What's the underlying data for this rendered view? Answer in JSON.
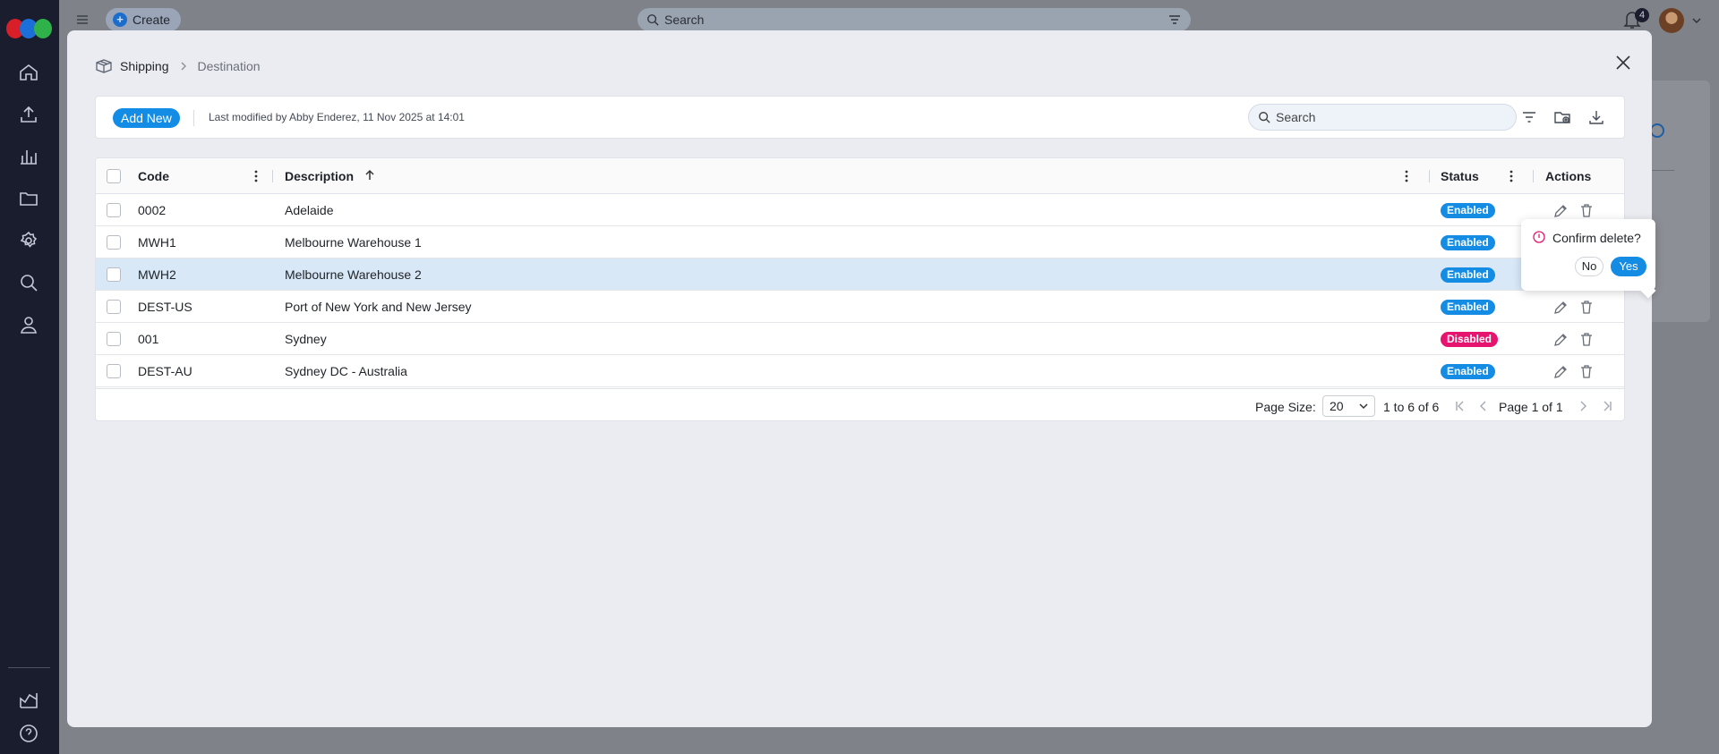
{
  "topbar": {
    "create_label": "Create",
    "search_placeholder": "Search",
    "notification_count": "4"
  },
  "modal": {
    "breadcrumb": {
      "root": "Shipping",
      "current": "Destination"
    },
    "toolbar": {
      "add_new_label": "Add New",
      "last_modified": "Last modified by Abby Enderez, 11 Nov 2025 at 14:01",
      "search_placeholder": "Search"
    },
    "grid": {
      "columns": {
        "code": "Code",
        "description": "Description",
        "status": "Status",
        "actions": "Actions"
      },
      "sort": {
        "column": "Description",
        "direction": "ascending"
      },
      "rows": [
        {
          "code": "0002",
          "description": "Adelaide",
          "status": "Enabled"
        },
        {
          "code": "MWH1",
          "description": "Melbourne Warehouse 1",
          "status": "Enabled"
        },
        {
          "code": "MWH2",
          "description": "Melbourne Warehouse 2",
          "status": "Enabled",
          "selected": true
        },
        {
          "code": "DEST-US",
          "description": "Port of New York and New Jersey",
          "status": "Enabled"
        },
        {
          "code": "001",
          "description": "Sydney",
          "status": "Disabled"
        },
        {
          "code": "DEST-AU",
          "description": "Sydney DC - Australia",
          "status": "Enabled"
        }
      ],
      "footer": {
        "page_size_label": "Page Size:",
        "page_size_value": "20",
        "range": "1 to 6 of 6",
        "page": "Page 1 of 1"
      }
    },
    "confirm": {
      "text": "Confirm delete?",
      "no_label": "No",
      "yes_label": "Yes"
    }
  },
  "colors": {
    "accent": "#148ce4",
    "enabled_badge": "#148ce4",
    "disabled_badge": "#e6146e",
    "delete_hot": "#e8166f",
    "rail": "#1a1d2e"
  }
}
